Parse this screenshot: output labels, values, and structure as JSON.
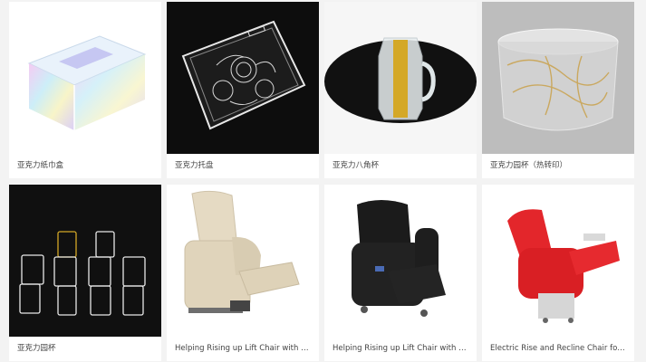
{
  "products": [
    {
      "title": "亚克力纸巾盒",
      "image": "acrylic-tissue-box-image"
    },
    {
      "title": "亚克力托盘",
      "image": "acrylic-tray-image"
    },
    {
      "title": "亚克力八角杯",
      "image": "acrylic-octagonal-cup-image"
    },
    {
      "title": "亚克力园杯（热转印）",
      "image": "acrylic-round-cup-heat-transfer-image"
    },
    {
      "title": "亚克力园杯",
      "image": "acrylic-round-cups-image"
    },
    {
      "title": "Helping Rising up Lift Chair with M...",
      "image": "beige-lift-chair-image"
    },
    {
      "title": "Helping Rising up Lift Chair with M...",
      "image": "black-lift-chair-image"
    },
    {
      "title": "Electric Rise and Recline Chair for...",
      "image": "red-recline-chair-image"
    }
  ]
}
